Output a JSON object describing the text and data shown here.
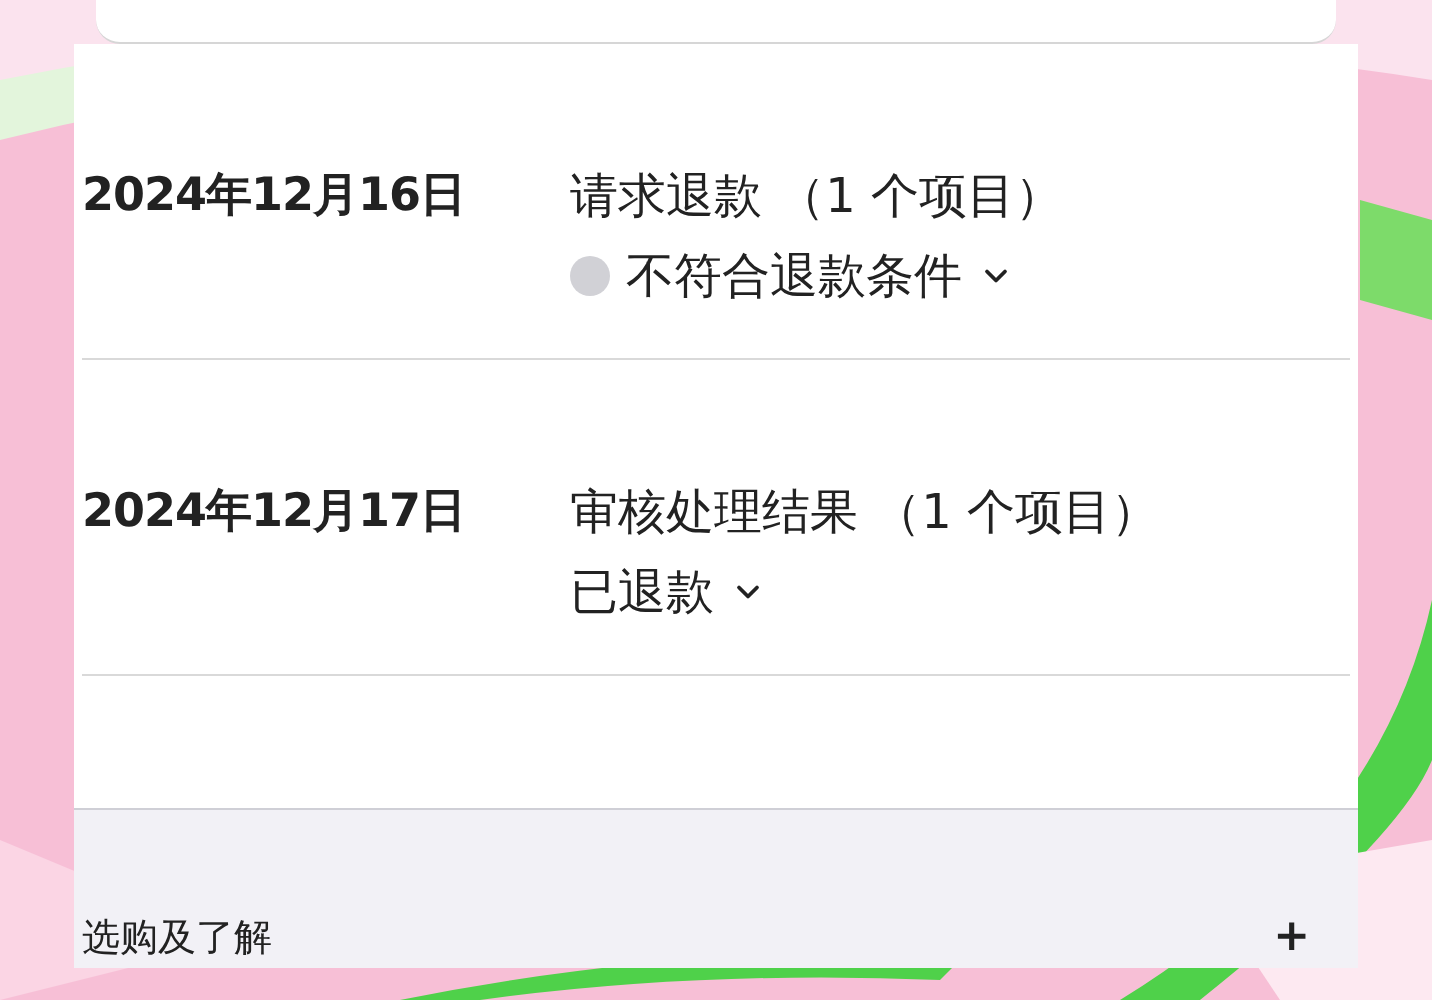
{
  "history": [
    {
      "date": "2024年12月16日",
      "title": "请求退款 （1 个项目）",
      "status": "不符合退款条件",
      "color": "#d1d1d6"
    },
    {
      "date": "2024年12月17日",
      "title": "审核处理结果 （1 个项目）",
      "status": "已退款"
    }
  ],
  "footer": {
    "label": "选购及了解",
    "toggle": "+"
  }
}
